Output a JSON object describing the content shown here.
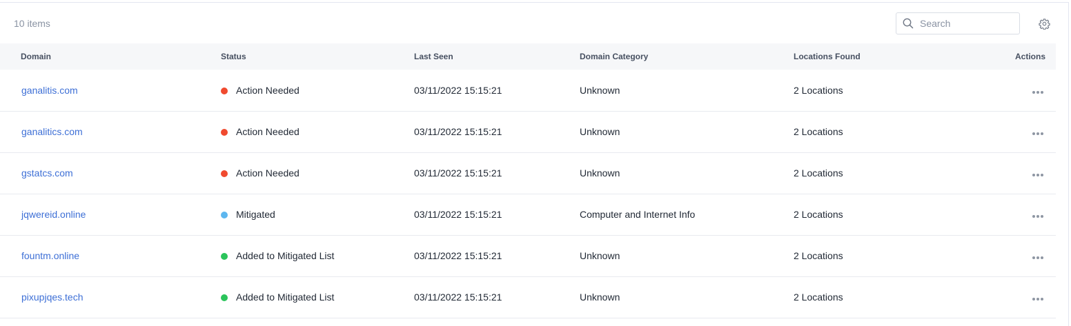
{
  "header": {
    "item_count": "10 items",
    "search_placeholder": "Search"
  },
  "table": {
    "columns": [
      "Domain",
      "Status",
      "Last Seen",
      "Domain Category",
      "Locations Found",
      "Actions"
    ],
    "rows": [
      {
        "domain": "ganalitis.com",
        "status": "Action Needed",
        "status_color": "#f04a2f",
        "last_seen": "03/11/2022 15:15:21",
        "category": "Unknown",
        "locations": "2 Locations"
      },
      {
        "domain": "ganalitics.com",
        "status": "Action Needed",
        "status_color": "#f04a2f",
        "last_seen": "03/11/2022 15:15:21",
        "category": "Unknown",
        "locations": "2 Locations"
      },
      {
        "domain": "gstatcs.com",
        "status": "Action Needed",
        "status_color": "#f04a2f",
        "last_seen": "03/11/2022 15:15:21",
        "category": "Unknown",
        "locations": "2 Locations"
      },
      {
        "domain": "jqwereid.online",
        "status": "Mitigated",
        "status_color": "#5db7ef",
        "last_seen": "03/11/2022 15:15:21",
        "category": "Computer and Internet Info",
        "locations": "2 Locations"
      },
      {
        "domain": "fountm.online",
        "status": "Added to Mitigated List",
        "status_color": "#2bc45b",
        "last_seen": "03/11/2022 15:15:21",
        "category": "Unknown",
        "locations": "2 Locations"
      },
      {
        "domain": "pixupjqes.tech",
        "status": "Added to Mitigated List",
        "status_color": "#2bc45b",
        "last_seen": "03/11/2022 15:15:21",
        "category": "Unknown",
        "locations": "2 Locations"
      }
    ]
  },
  "icons": {
    "search": "search-icon",
    "settings": "gear-icon",
    "row_actions": "more-horizontal-icon"
  }
}
